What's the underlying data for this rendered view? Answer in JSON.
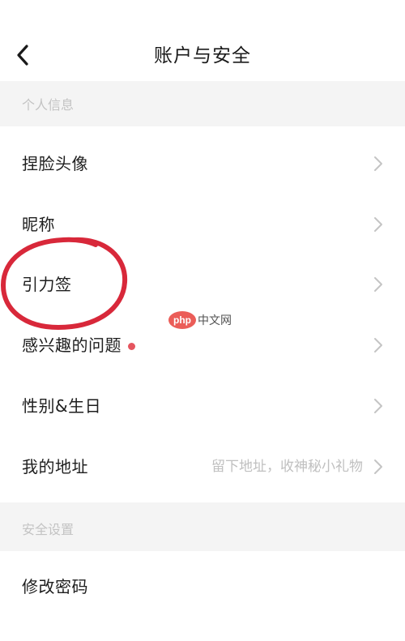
{
  "header": {
    "title": "账户与安全",
    "back_icon": "chevron-left-icon"
  },
  "sections": [
    {
      "label": "个人信息",
      "items": [
        {
          "label": "捏脸头像",
          "hint": "",
          "badge": false
        },
        {
          "label": "昵称",
          "hint": "",
          "badge": false
        },
        {
          "label": "引力签",
          "hint": "",
          "badge": false,
          "annotated": true
        },
        {
          "label": "感兴趣的问题",
          "hint": "",
          "badge": true
        },
        {
          "label": "性别&生日",
          "hint": "",
          "badge": false
        },
        {
          "label": "我的地址",
          "hint": "留下地址，收神秘小礼物",
          "badge": false
        }
      ]
    },
    {
      "label": "安全设置",
      "items": [
        {
          "label": "修改密码",
          "hint": "",
          "badge": false
        }
      ]
    }
  ],
  "annotation": {
    "color": "#d8283a",
    "shape": "hand-drawn-circle"
  },
  "watermark": {
    "logo": "php",
    "text": "中文网"
  },
  "colors": {
    "section_bg": "#f4f4f4",
    "section_text": "#c3c3c3",
    "badge": "#e5555f",
    "chevron": "#c4c4c4"
  }
}
